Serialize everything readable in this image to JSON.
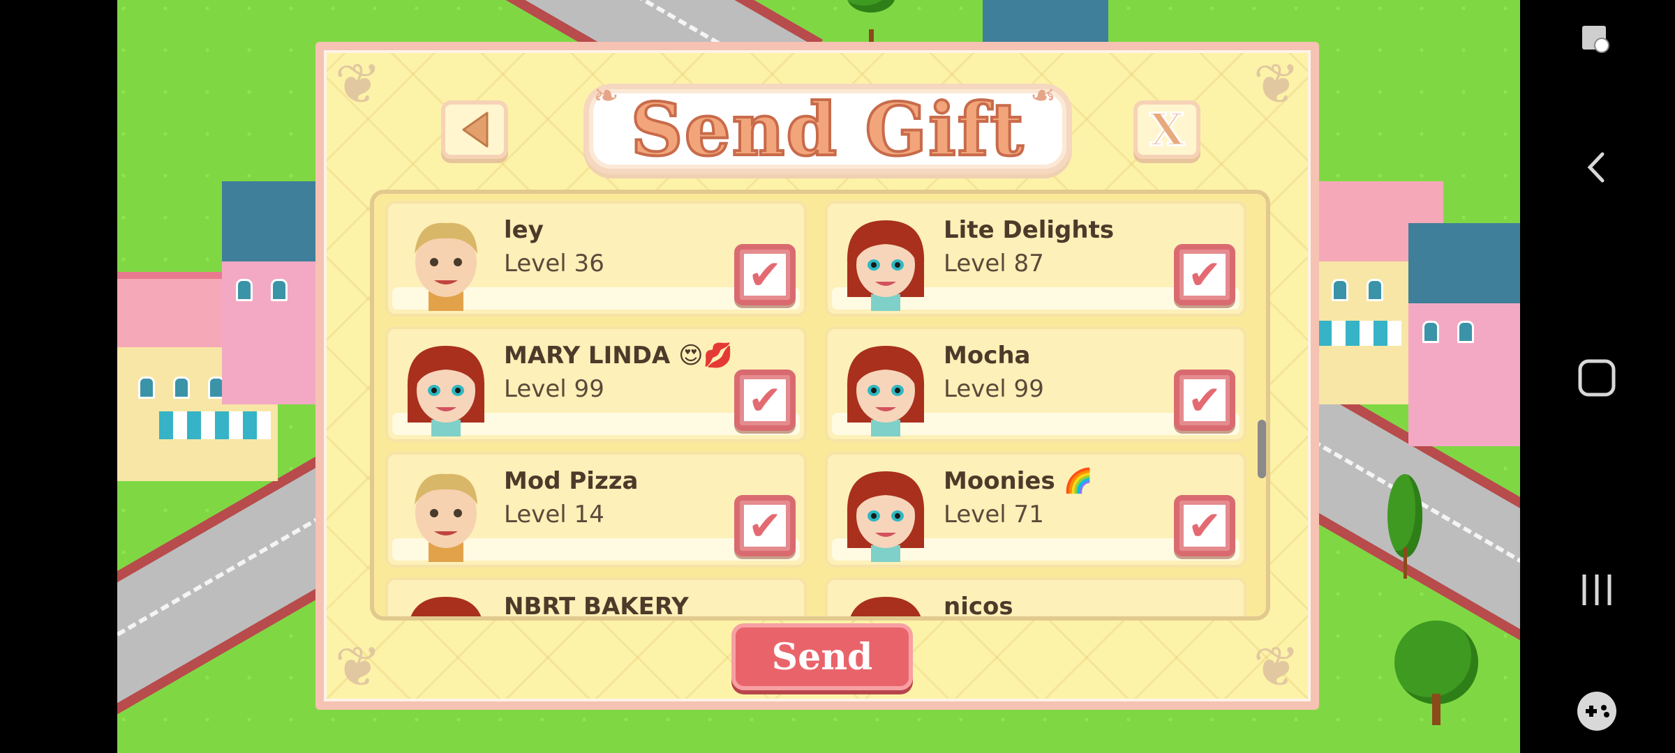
{
  "dialog": {
    "title": "Send Gift",
    "close_label": "X",
    "send_label": "Send"
  },
  "friends": [
    {
      "name": "ley",
      "level": "Level 36",
      "avatar": "boy",
      "checked": true
    },
    {
      "name": "Lite Delights",
      "level": "Level 87",
      "avatar": "girl",
      "checked": true
    },
    {
      "name": "MARY LINDA 😍💋",
      "level": "Level 99",
      "avatar": "girl",
      "checked": true
    },
    {
      "name": "Mocha",
      "level": "Level 99",
      "avatar": "girl",
      "checked": true
    },
    {
      "name": "Mod Pizza",
      "level": "Level 14",
      "avatar": "boy",
      "checked": true
    },
    {
      "name": "Moonies 🌈",
      "level": "Level 71",
      "avatar": "girl",
      "checked": true
    },
    {
      "name": "NBRT BAKERY",
      "level": "",
      "avatar": "girl",
      "checked": true
    },
    {
      "name": "nicos",
      "level": "",
      "avatar": "girl",
      "checked": true
    }
  ],
  "icons": {
    "back": "back-arrow-icon",
    "check": "checkmark-icon",
    "nav_back": "chevron-left-icon",
    "nav_home": "home-square-icon",
    "nav_recents": "recents-icon",
    "game_tools": "gamepad-icon",
    "screen_lock": "rotation-lock-icon"
  },
  "colors": {
    "dialog_bg": "#fdf3a8",
    "accent": "#e9646a",
    "title": "#f2a57a",
    "grass": "#7fd843"
  }
}
